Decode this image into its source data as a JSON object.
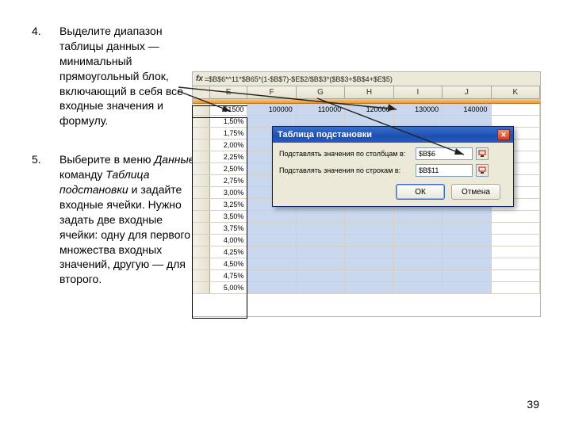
{
  "instructions": {
    "item4": {
      "num": "4.",
      "text_a": "Выделите диапазон таблицы данных — минимальный прямоугольный блок, включающий в себя все входные значения и формулу."
    },
    "item5": {
      "num": "5.",
      "text_a": " Выберите в меню ",
      "menu": "Данные",
      "text_b": " команду ",
      "cmd": "Таблица подстановки",
      "text_c": " и задайте входные ячейки. Нужно задать две входные ячейки: одну для первого множества входных значений, другую — для второго."
    }
  },
  "excel": {
    "formula_bar": "=$B$6*^11*$B65*(1-$B$7)-$E$2/$B$3*($B$3+$B$4+$E$5)",
    "col_headers": [
      "E",
      "F",
      "G",
      "H",
      "I",
      "J",
      "K"
    ],
    "first_row": {
      "E": "-51500",
      "F": "100000",
      "G": "110000",
      "H": "120000",
      "I": "130000",
      "J": "140000"
    },
    "side_values": [
      "1,50%",
      "1,75%",
      "2,00%",
      "2,25%",
      "2,50%",
      "2,75%",
      "3,00%",
      "3,25%",
      "3,50%",
      "3,75%",
      "4,00%",
      "4,25%",
      "4,50%",
      "4,75%",
      "5,00%"
    ]
  },
  "dialog": {
    "title": "Таблица подстановки",
    "label_col": "Подставлять значения по столбцам в:",
    "label_row": "Подставлять значения по строкам в:",
    "input_col": "$B$6",
    "input_row": "$B$11",
    "ok": "ОК",
    "cancel": "Отмена"
  },
  "page_number": "39"
}
